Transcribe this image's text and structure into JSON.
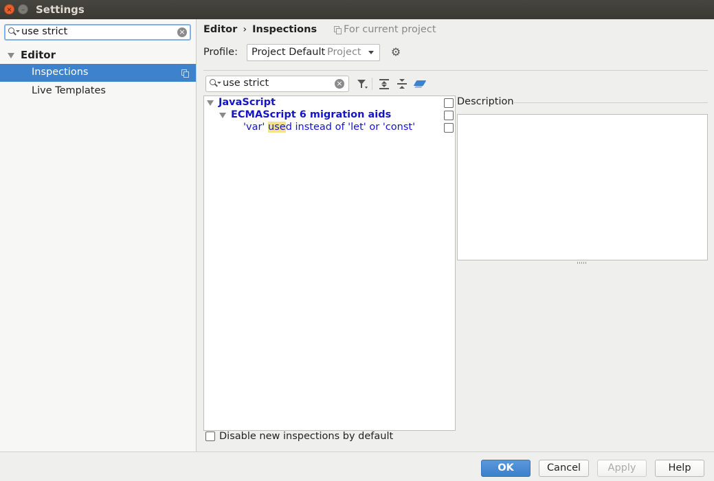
{
  "window": {
    "title": "Settings",
    "close_glyph": "×",
    "minimize_glyph": "–"
  },
  "sidebar": {
    "search_value": "use strict",
    "clear_glyph": "×",
    "items": [
      {
        "label": "Editor",
        "level": 0,
        "expanded": true,
        "selected": false
      },
      {
        "label": "Inspections",
        "level": 1,
        "selected": true,
        "icon": "copy-icon"
      },
      {
        "label": "Live Templates",
        "level": 1,
        "selected": false
      }
    ]
  },
  "breadcrumb": {
    "parent": "Editor",
    "separator": "›",
    "current": "Inspections",
    "scope_text": "For current project",
    "scope_icon": "copy-icon"
  },
  "profile": {
    "label": "Profile:",
    "value": "Project Default",
    "scope": "Project",
    "settings_icon": "gear-icon",
    "gear_glyph": "⚙"
  },
  "inspections_toolbar": {
    "search_value": "use strict",
    "clear_glyph": "×",
    "icons": [
      "filter-icon",
      "expand-all-icon",
      "collapse-all-icon",
      "reset-icon"
    ]
  },
  "inspection_tree": [
    {
      "label": "JavaScript",
      "level": 0,
      "bold": true,
      "expanded": true,
      "checked": false
    },
    {
      "label": "ECMAScript 6 migration aids",
      "level": 1,
      "bold": true,
      "expanded": true,
      "checked": false
    },
    {
      "label_prefix": "'var' ",
      "label_highlight": "use",
      "label_suffix": "d instead of 'let' or 'const'",
      "level": 2,
      "bold": false,
      "checked": false
    }
  ],
  "description": {
    "label": "Description",
    "content": ""
  },
  "footer_option": {
    "label": "Disable new inspections by default",
    "checked": false
  },
  "buttons": {
    "ok": "OK",
    "cancel": "Cancel",
    "apply": "Apply",
    "help": "Help"
  },
  "colors": {
    "selection": "#3d82cc",
    "inspection_text": "#1515c8",
    "search_highlight": "#f6e28d",
    "titlebar": "#3a3934"
  }
}
